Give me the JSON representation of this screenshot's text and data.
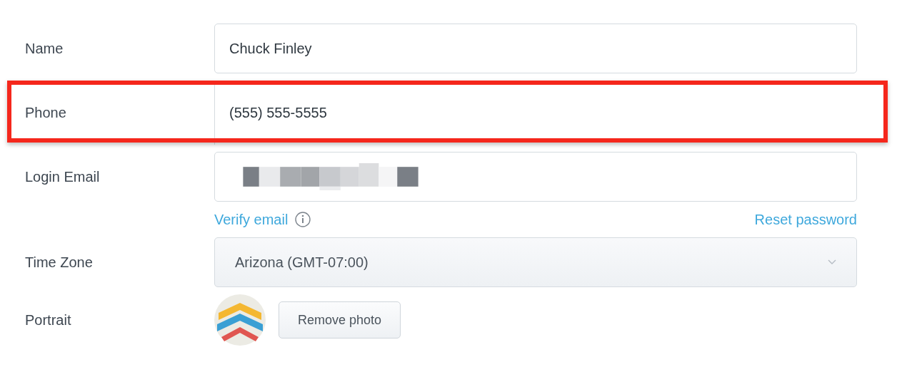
{
  "fields": [
    {
      "kind": "text",
      "label": "Name",
      "value": "Chuck Finley",
      "highlighted": false
    },
    {
      "kind": "text",
      "label": "Phone",
      "value": "(555) 555-5555",
      "highlighted": true
    },
    {
      "kind": "redacted",
      "label": "Login Email",
      "links": {
        "verify": "Verify email",
        "reset": "Reset password"
      },
      "highlighted": false
    },
    {
      "kind": "select",
      "label": "Time Zone",
      "value": "Arizona (GMT-07:00)",
      "highlighted": false
    },
    {
      "kind": "photo",
      "label": "Portrait",
      "button": "Remove photo",
      "highlighted": false
    }
  ]
}
